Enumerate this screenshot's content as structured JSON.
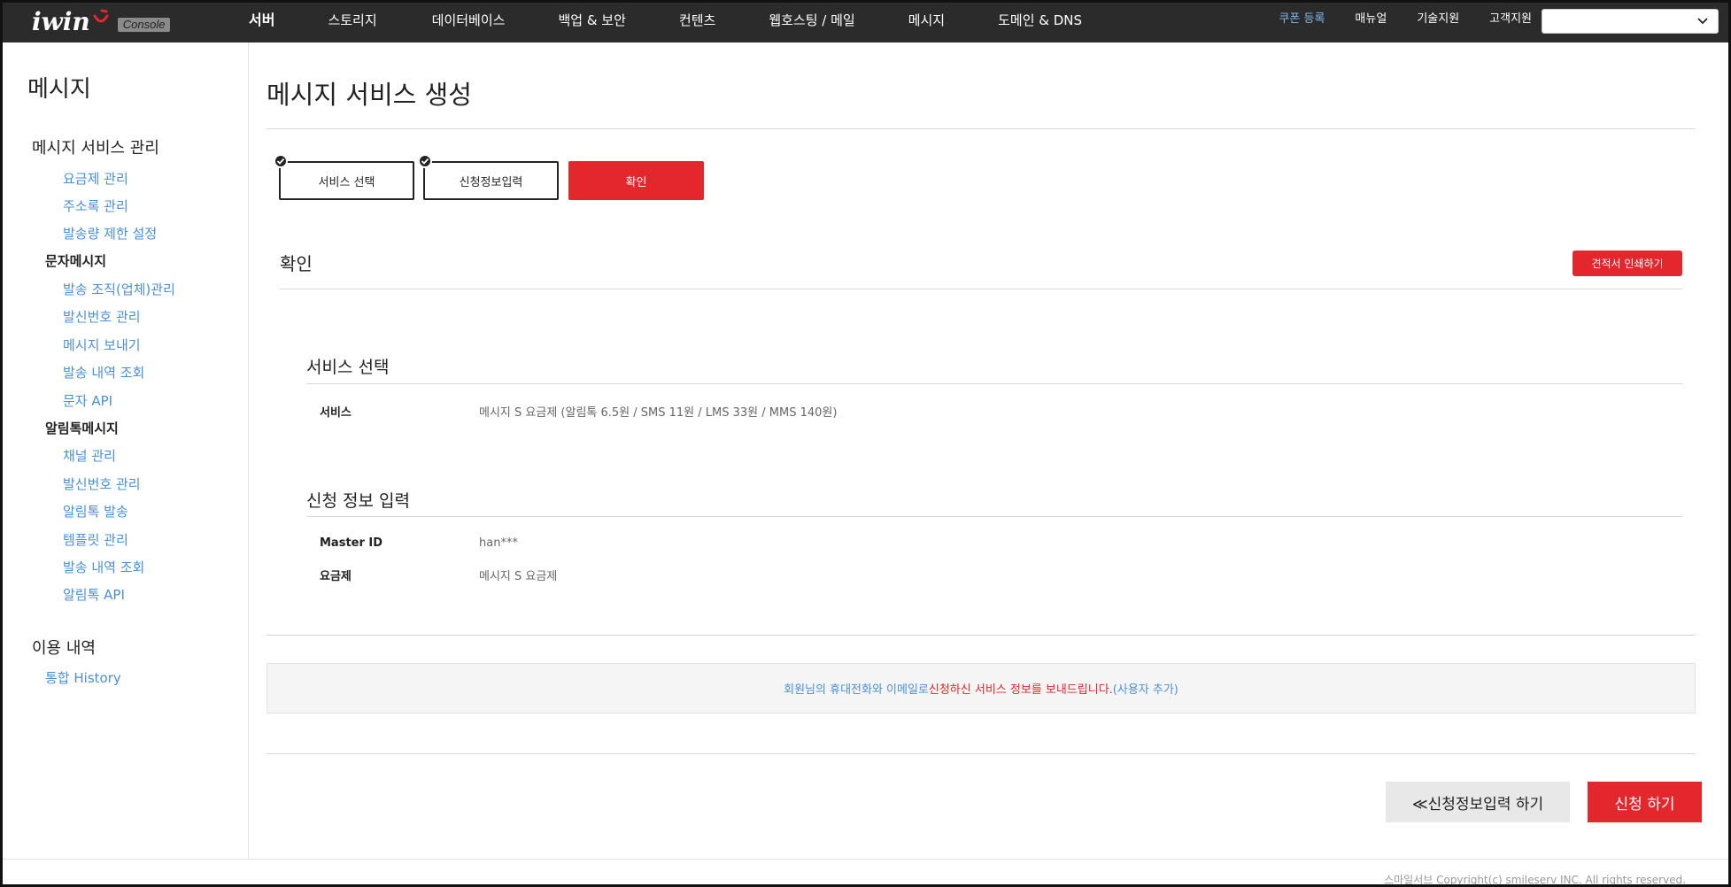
{
  "header": {
    "logo_text": "iwin",
    "logo_badge": "Console",
    "nav": [
      "서버",
      "스토리지",
      "데이터베이스",
      "백업 & 보안",
      "컨텐츠",
      "웹호스팅 / 메일",
      "메시지",
      "도메인 & DNS"
    ],
    "util": [
      "쿠폰 등록",
      "매뉴얼",
      "기술지원",
      "고객지원"
    ],
    "select_value": ""
  },
  "sidebar": {
    "title": "메시지",
    "group1": "메시지 서비스 관리",
    "group1_items": [
      "요금제 관리",
      "주소록 관리",
      "발송량 제한 설정"
    ],
    "sub1": "문자메시지",
    "sub1_items": [
      "발송 조직(업체)관리",
      "발신번호 관리",
      "메시지 보내기",
      "발송 내역 조회",
      "문자 API"
    ],
    "sub2": "알림톡메시지",
    "sub2_items": [
      "채널 관리",
      "발신번호 관리",
      "알림톡 발송",
      "템플릿 관리",
      "발송 내역 조회",
      "알림톡 API"
    ],
    "group2": "이용 내역",
    "group2_items": [
      "통합 History"
    ]
  },
  "main": {
    "title": "메시지 서비스 생성",
    "steps": [
      "서비스 선택",
      "신청정보입력",
      "확인"
    ],
    "section_title": "확인",
    "print_button": "견적서 인쇄하기",
    "service_section": {
      "title": "서비스 선택",
      "key": "서비스",
      "value": "메시지 S 요금제 (알림톡 6.5원 / SMS 11원 / LMS 33원 / MMS 140원)"
    },
    "apply_section": {
      "title": "신청 정보 입력",
      "rows": [
        {
          "key": "Master ID",
          "value": "han***"
        },
        {
          "key": "요금제",
          "value": "메시지 S 요금제"
        }
      ]
    },
    "notice": {
      "part1": "회원님의 휴대전화와 이메일로 ",
      "part2": "신청하신 서비스 정보를 보내드립니다.",
      "part3": " (사용자 추가)"
    },
    "back_button": "≪신청정보입력 하기",
    "submit_button": "신청 하기"
  },
  "footer": {
    "copyright": "스마일서브 Copyright(c) smileserv INC. All rights reserved."
  },
  "colors": {
    "accent": "#e4262d",
    "link": "#4a90d9",
    "topbar": "#2b2b2b"
  }
}
